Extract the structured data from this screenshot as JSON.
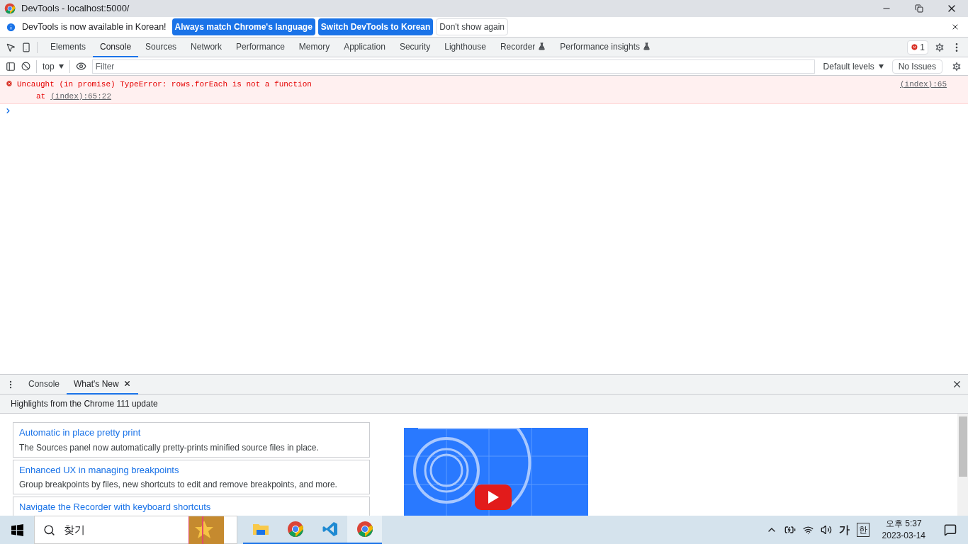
{
  "window": {
    "title": "DevTools - localhost:5000/"
  },
  "infobar": {
    "message": "DevTools is now available in Korean!",
    "buttons": [
      {
        "label": "Always match Chrome's language",
        "kind": "primary"
      },
      {
        "label": "Switch DevTools to Korean",
        "kind": "primary"
      },
      {
        "label": "Don't show again",
        "kind": "secondary"
      }
    ]
  },
  "tabs": [
    {
      "label": "Elements",
      "selected": false,
      "experimental": false
    },
    {
      "label": "Console",
      "selected": true,
      "experimental": false
    },
    {
      "label": "Sources",
      "selected": false,
      "experimental": false
    },
    {
      "label": "Network",
      "selected": false,
      "experimental": false
    },
    {
      "label": "Performance",
      "selected": false,
      "experimental": false
    },
    {
      "label": "Memory",
      "selected": false,
      "experimental": false
    },
    {
      "label": "Application",
      "selected": false,
      "experimental": false
    },
    {
      "label": "Security",
      "selected": false,
      "experimental": false
    },
    {
      "label": "Lighthouse",
      "selected": false,
      "experimental": false
    },
    {
      "label": "Recorder",
      "selected": false,
      "experimental": true
    },
    {
      "label": "Performance insights",
      "selected": false,
      "experimental": true
    }
  ],
  "error_count": "1",
  "console_toolbar": {
    "context": "top",
    "filter_placeholder": "Filter",
    "levels": "Default levels",
    "issues": "No Issues"
  },
  "messages": [
    {
      "text": "Uncaught (in promise) TypeError: rows.forEach is not a function",
      "stack_prefix": "at",
      "stack_link": "(index):65:22",
      "source": "(index):65"
    }
  ],
  "drawer": {
    "tabs": [
      {
        "label": "Console",
        "selected": false,
        "closable": false
      },
      {
        "label": "What's New",
        "selected": true,
        "closable": true
      }
    ],
    "header": "Highlights from the Chrome 111 update",
    "cards": [
      {
        "title": "Automatic in place pretty print",
        "description": "The Sources panel now automatically pretty-prints minified source files in place."
      },
      {
        "title": "Enhanced UX in managing breakpoints",
        "description": "Group breakpoints by files, new shortcuts to edit and remove breakpoints, and more."
      },
      {
        "title": "Navigate the Recorder with keyboard shortcuts"
      }
    ]
  },
  "taskbar": {
    "search_placeholder": "찾기",
    "apps": [
      {
        "kind": "folder",
        "selected": false
      },
      {
        "kind": "chrome",
        "selected": false
      },
      {
        "kind": "vscode",
        "selected": false
      },
      {
        "kind": "chrome",
        "selected": true
      }
    ],
    "ime_mode": "가",
    "ime": "한",
    "time": "오후 5:37",
    "date": "2023-03-14"
  }
}
